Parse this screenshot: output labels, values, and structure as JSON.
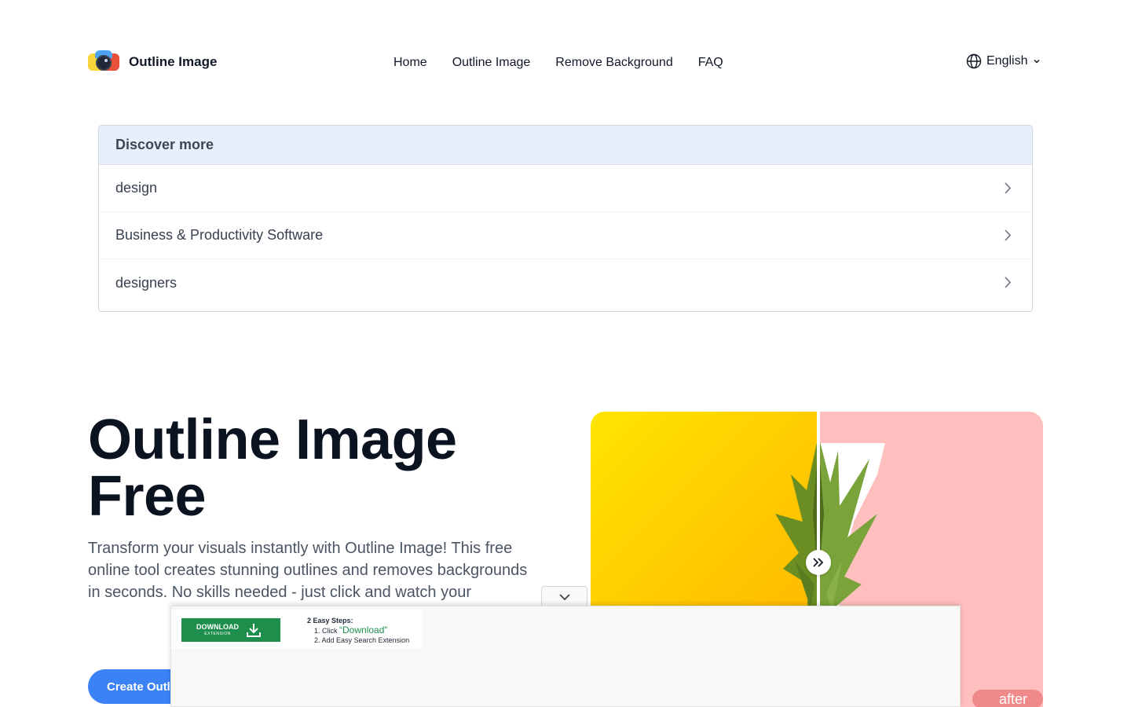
{
  "header": {
    "logo_text": "Outline Image",
    "nav": [
      "Home",
      "Outline Image",
      "Remove Background",
      "FAQ"
    ],
    "language": "English"
  },
  "discover": {
    "title": "Discover more",
    "items": [
      "design",
      "Business & Productivity Software",
      "designers"
    ]
  },
  "hero": {
    "title_line1": "Outline Image",
    "title_line2": "Free",
    "description": "Transform your visuals instantly with Outline Image! This free online tool creates stunning outlines and removes backgrounds in seconds. No skills needed - just click and watch your",
    "cta": "Create Outl",
    "after_label": "after"
  },
  "ad": {
    "button_main": "DOWNLOAD",
    "button_sub": "EXTENSION",
    "steps_title": "2 Easy Steps:",
    "step1_prefix": "1. Click ",
    "step1_highlight": "“Download”",
    "step2": "2. Add Easy Search Extension"
  },
  "colors": {
    "accent": "#3b82f6",
    "ad_green": "#1e8e4c",
    "after_bg": "#ffbfbf"
  }
}
